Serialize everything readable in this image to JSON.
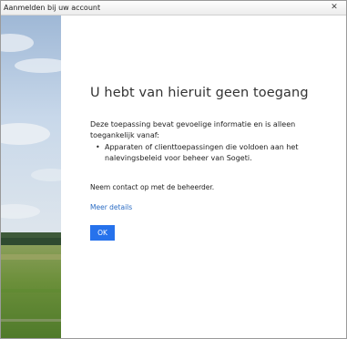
{
  "window": {
    "title": "Aanmelden bij uw account",
    "close_glyph": "✕"
  },
  "background_photo": {
    "icon": "landscape-image",
    "sky_color": "#c8d8ea",
    "field_color": "#6b8f3a"
  },
  "message": {
    "heading": "U hebt van hieruit geen toegang",
    "description": "Deze toepassing bevat gevoelige informatie en is alleen toegankelijk vanaf:",
    "bullets": [
      "Apparaten of clienttoepassingen die voldoen aan het nalevingsbeleid voor beheer van Sogeti."
    ],
    "contact": "Neem contact op met de beheerder.",
    "details_link": "Meer details",
    "ok_label": "OK"
  },
  "colors": {
    "accent": "#2672ec",
    "link": "#2b6cc4"
  }
}
